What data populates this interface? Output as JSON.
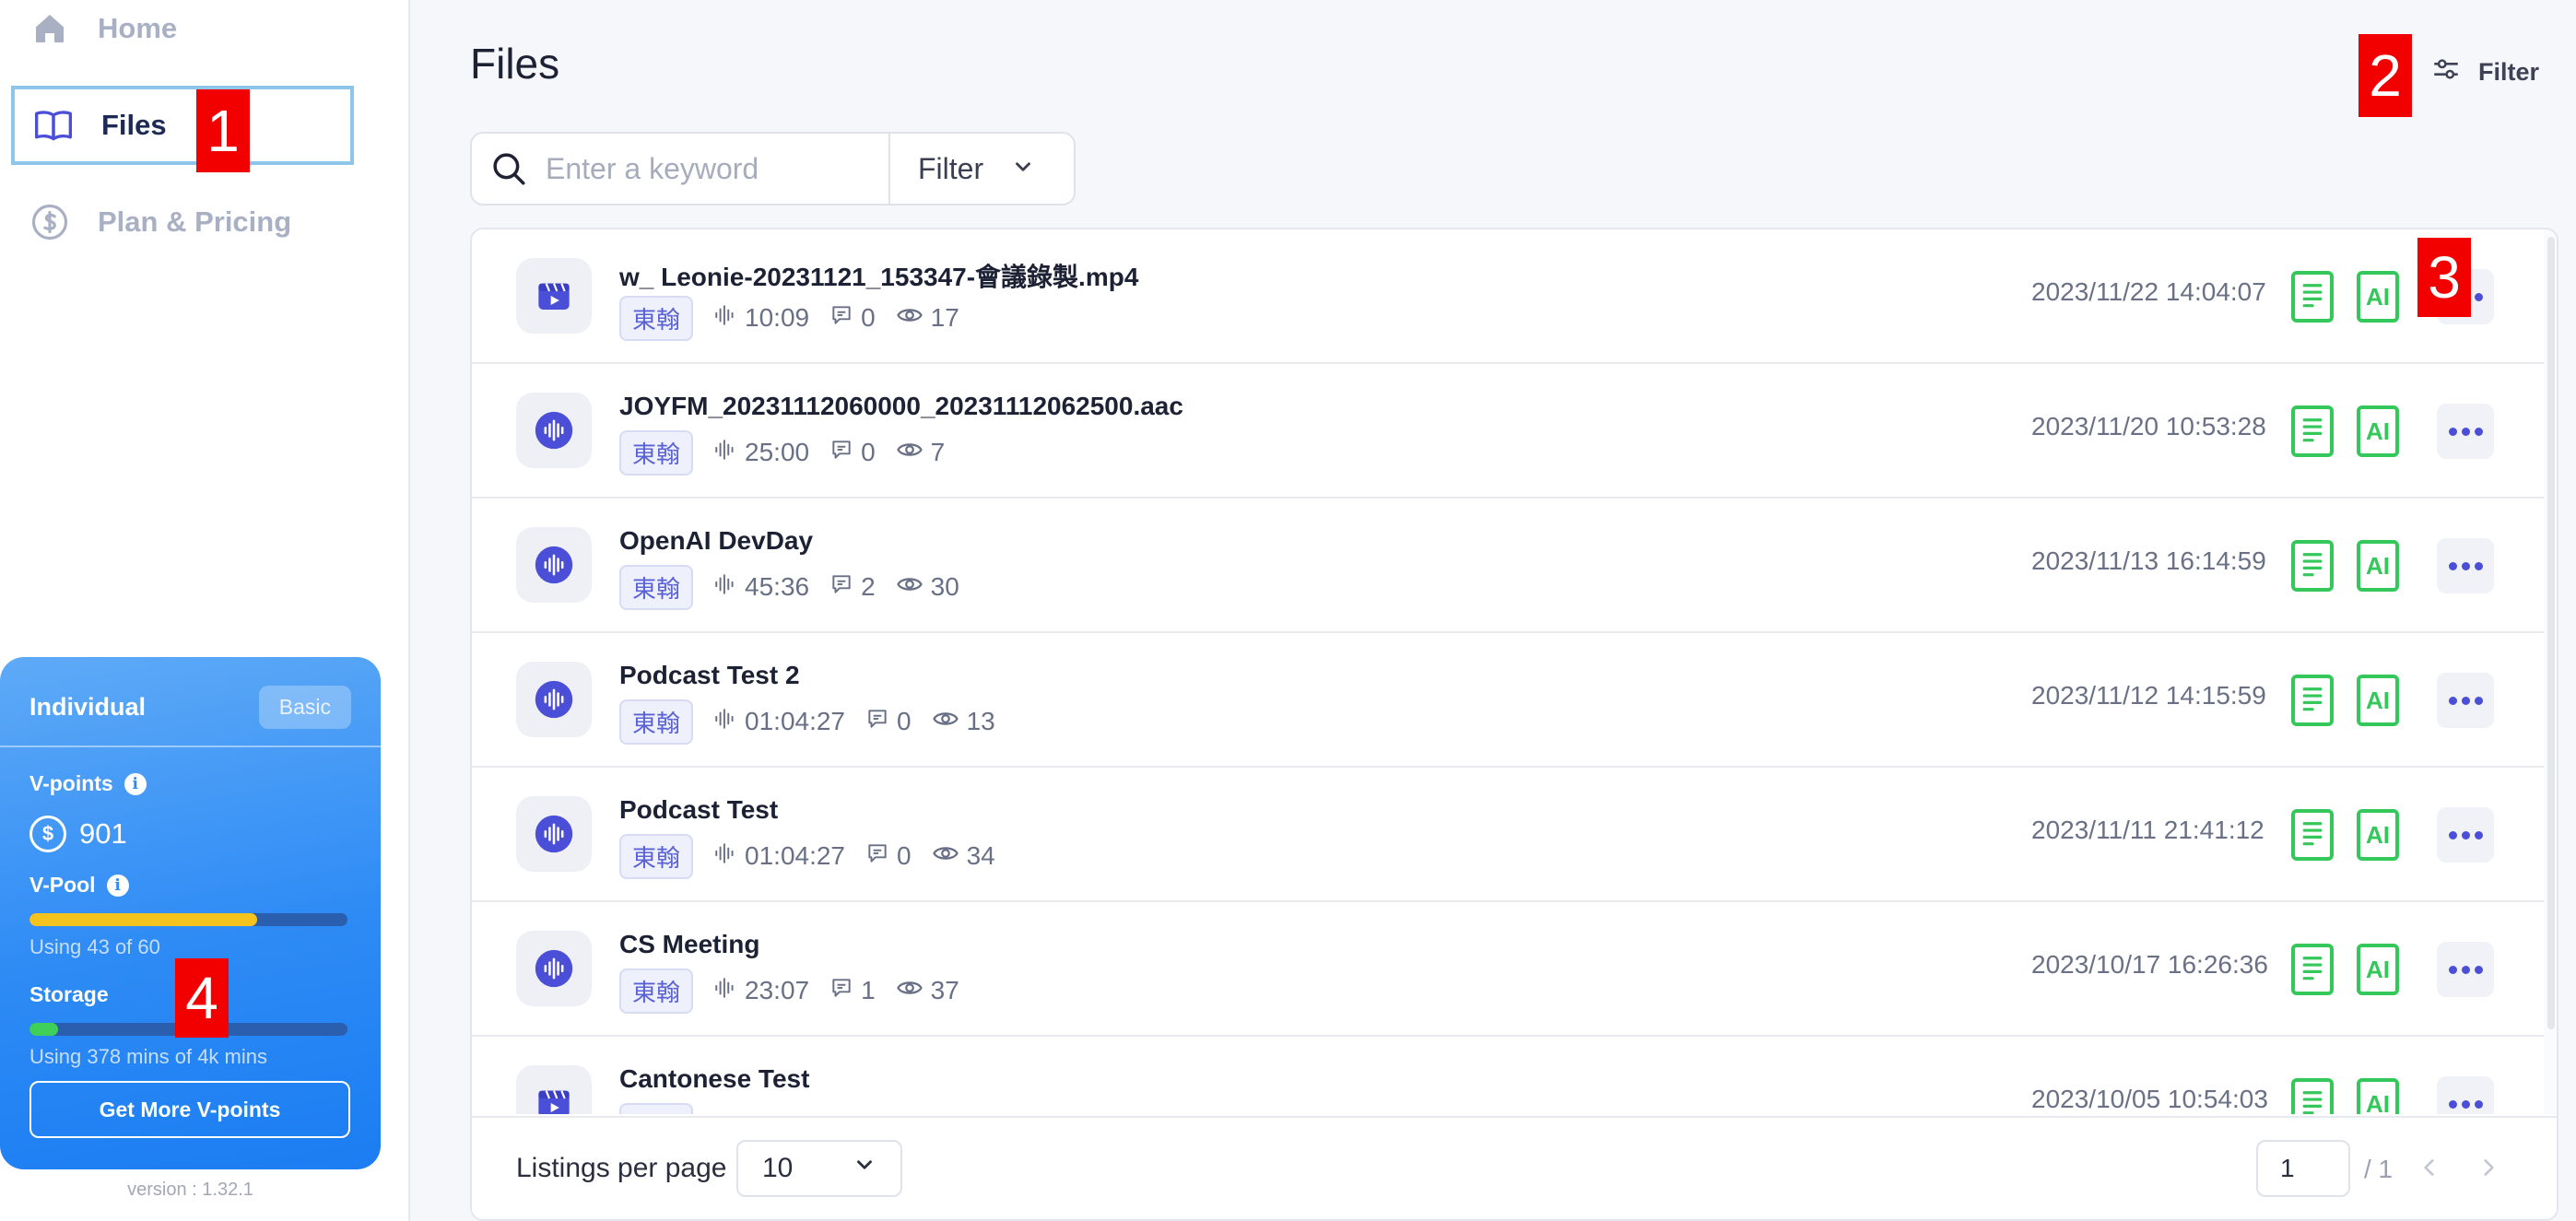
{
  "sidebar": {
    "nav": [
      {
        "label": "Home",
        "icon": "home-icon",
        "active": false
      },
      {
        "label": "Files",
        "icon": "book-icon",
        "active": true
      },
      {
        "label": "Plan & Pricing",
        "icon": "dollar-circle-icon",
        "active": false
      }
    ],
    "plan": {
      "name": "Individual",
      "tier": "Basic",
      "vpoints_label": "V-points",
      "vpoints_value": "901",
      "vpool_label": "V-Pool",
      "vpool_fraction": 0.7167,
      "vpool_text": "Using 43 of 60",
      "storage_label": "Storage",
      "storage_fraction": 0.09,
      "storage_text": "Using 378 mins of 4k mins",
      "cta_label": "Get More V-points"
    },
    "version": "version : 1.32.1"
  },
  "header": {
    "title": "Files",
    "filter_label": "Filter"
  },
  "search": {
    "placeholder": "Enter a keyword",
    "filter_label": "Filter"
  },
  "files": [
    {
      "title": "w_ Leonie-20231121_153347-會議錄製.mp4",
      "type": "video",
      "owner": "東翰",
      "duration": "10:09",
      "comments": "0",
      "views": "17",
      "date": "2023/11/22 14:04:07"
    },
    {
      "title": "JOYFM_20231112060000_20231112062500.aac",
      "type": "audio",
      "owner": "東翰",
      "duration": "25:00",
      "comments": "0",
      "views": "7",
      "date": "2023/11/20 10:53:28"
    },
    {
      "title": "OpenAI DevDay",
      "type": "audio",
      "owner": "東翰",
      "duration": "45:36",
      "comments": "2",
      "views": "30",
      "date": "2023/11/13 16:14:59"
    },
    {
      "title": "Podcast Test 2",
      "type": "audio",
      "owner": "東翰",
      "duration": "01:04:27",
      "comments": "0",
      "views": "13",
      "date": "2023/11/12 14:15:59"
    },
    {
      "title": "Podcast Test",
      "type": "audio",
      "owner": "東翰",
      "duration": "01:04:27",
      "comments": "0",
      "views": "34",
      "date": "2023/11/11 21:41:12"
    },
    {
      "title": "CS Meeting",
      "type": "audio",
      "owner": "東翰",
      "duration": "23:07",
      "comments": "1",
      "views": "37",
      "date": "2023/10/17 16:26:36"
    },
    {
      "title": "Cantonese Test",
      "type": "video",
      "owner": "東翰",
      "duration": "",
      "comments": "",
      "views": "",
      "date": "2023/10/05 10:54:03"
    }
  ],
  "actions": {
    "ai_label": "AI"
  },
  "pagination": {
    "per_page_label": "Listings per page",
    "per_page_value": "10",
    "current_page": "1",
    "total_pages": "/ 1"
  },
  "markers": [
    "1",
    "2",
    "3",
    "4"
  ],
  "colors": {
    "accent": "#4b4fd8",
    "success": "#34c759",
    "plan_blue": "#2e8bf5",
    "vpool": "#f5c31e",
    "storage": "#3fd05a"
  }
}
